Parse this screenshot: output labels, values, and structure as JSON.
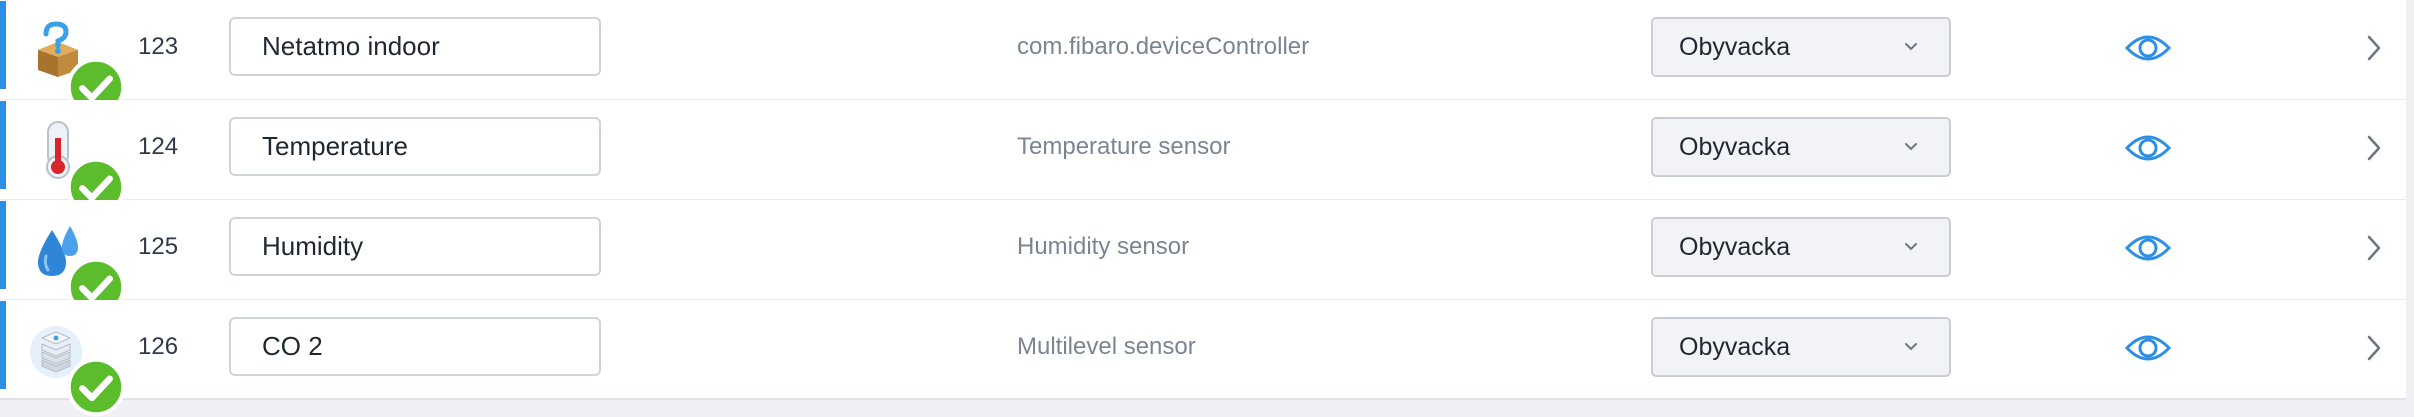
{
  "devices": [
    {
      "id": "123",
      "name": "Netatmo indoor",
      "type": "com.fibaro.deviceController",
      "room": "Obyvacka",
      "icon": "unknown-device-box-icon"
    },
    {
      "id": "124",
      "name": "Temperature",
      "type": "Temperature sensor",
      "room": "Obyvacka",
      "icon": "thermometer-icon"
    },
    {
      "id": "125",
      "name": "Humidity",
      "type": "Humidity sensor",
      "room": "Obyvacka",
      "icon": "water-drops-icon"
    },
    {
      "id": "126",
      "name": "CO 2",
      "type": "Multilevel sensor",
      "room": "Obyvacka",
      "icon": "multilevel-sensor-icon"
    }
  ],
  "colors": {
    "accent": "#2d8fe3",
    "status_ok": "#5bbd2b",
    "eye_icon": "#2d8fe3",
    "type_text": "#7a8593"
  },
  "icons": {
    "status": "check-badge-icon",
    "visibility": "eye-icon",
    "room_dropdown": "chevron-down-icon",
    "row_action": "chevron-right-icon"
  }
}
